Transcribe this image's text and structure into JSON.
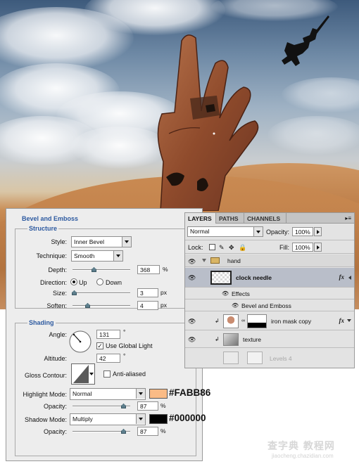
{
  "colors": {
    "highlight": "#FABB86",
    "shadow": "#000000",
    "accent": "#2d5aa0"
  },
  "bevel": {
    "title": "Bevel and Emboss",
    "structure": {
      "title": "Structure",
      "style_label": "Style:",
      "style_value": "Inner Bevel",
      "technique_label": "Technique:",
      "technique_value": "Smooth",
      "depth_label": "Depth:",
      "depth_value": "368",
      "depth_unit": "%",
      "direction_label": "Direction:",
      "direction_up": "Up",
      "direction_down": "Down",
      "size_label": "Size:",
      "size_value": "3",
      "size_unit": "px",
      "soften_label": "Soften:",
      "soften_value": "4",
      "soften_unit": "px"
    },
    "shading": {
      "title": "Shading",
      "angle_label": "Angle:",
      "angle_value": "131",
      "angle_unit": "°",
      "global_light_label": "Use Global Light",
      "altitude_label": "Altitude:",
      "altitude_value": "42",
      "altitude_unit": "°",
      "gloss_label": "Gloss Contour:",
      "anti_aliased_label": "Anti-aliased",
      "highlight_mode_label": "Highlight Mode:",
      "highlight_mode_value": "Normal",
      "highlight_opacity_label": "Opacity:",
      "highlight_opacity_value": "87",
      "highlight_opacity_unit": "%",
      "shadow_mode_label": "Shadow Mode:",
      "shadow_mode_value": "Multiply",
      "shadow_opacity_label": "Opacity:",
      "shadow_opacity_value": "87",
      "shadow_opacity_unit": "%"
    },
    "annotations": {
      "highlight_hex": "#FABB86",
      "shadow_hex": "#000000"
    }
  },
  "layers": {
    "tabs": [
      "LAYERS",
      "PATHS",
      "CHANNELS"
    ],
    "blend_mode": "Normal",
    "opacity_label": "Opacity:",
    "opacity_value": "100%",
    "lock_label": "Lock:",
    "fill_label": "Fill:",
    "fill_value": "100%",
    "items": [
      {
        "name": "hand"
      },
      {
        "name": "clock needle"
      },
      {
        "name": "Effects"
      },
      {
        "name": "Bevel and Emboss"
      },
      {
        "name": "iron mask copy"
      },
      {
        "name": "texture"
      },
      {
        "name": "Levels 4"
      }
    ]
  },
  "watermark": {
    "line1": "查字典 教程网",
    "line2": "jiaocheng.chazidian.com"
  }
}
